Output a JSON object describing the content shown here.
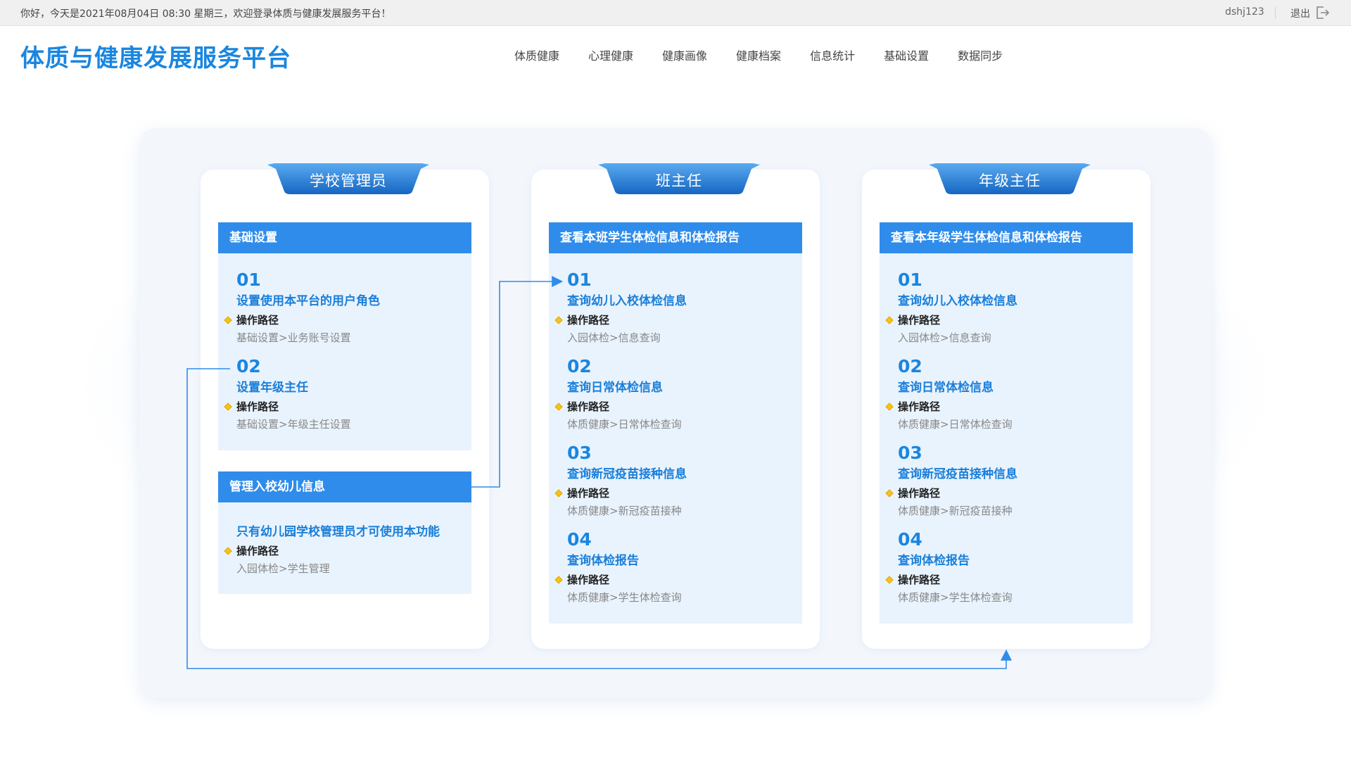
{
  "topbar": {
    "greeting": "你好，今天是2021年08月04日 08:30  星期三，欢迎登录体质与健康发展服务平台！",
    "username": "dshj123",
    "logout_label": "退出",
    "logout_icon": "logout-icon"
  },
  "header": {
    "brand": "体质与健康发展服务平台",
    "nav": [
      "体质健康",
      "心理健康",
      "健康画像",
      "健康档案",
      "信息统计",
      "基础设置",
      "数据同步"
    ]
  },
  "colors": {
    "accent": "#1a86e0",
    "section_head": "#2f8ceb",
    "section_body": "#e9f3fd",
    "ribbon": "#1f78d1",
    "diamond": "#f7c21b"
  },
  "op_label": "操作路径",
  "cards": [
    {
      "role": "学校管理员",
      "sections": [
        {
          "title": "基础设置",
          "items": [
            {
              "num": "01",
              "title": "设置使用本平台的用户角色",
              "path": "基础设置>业务账号设置"
            },
            {
              "num": "02",
              "title": "设置年级主任",
              "path": "基础设置>年级主任设置"
            }
          ]
        },
        {
          "title": "管理入校幼儿信息",
          "items": [
            {
              "num": "",
              "title": "只有幼儿园学校管理员才可使用本功能",
              "path": "入园体检>学生管理"
            }
          ]
        }
      ]
    },
    {
      "role": "班主任",
      "sections": [
        {
          "title": "查看本班学生体检信息和体检报告",
          "items": [
            {
              "num": "01",
              "title": "查询幼儿入校体检信息",
              "path": "入园体检>信息查询"
            },
            {
              "num": "02",
              "title": "查询日常体检信息",
              "path": "体质健康>日常体检查询"
            },
            {
              "num": "03",
              "title": "查询新冠疫苗接种信息",
              "path": "体质健康>新冠疫苗接种"
            },
            {
              "num": "04",
              "title": "查询体检报告",
              "path": "体质健康>学生体检查询"
            }
          ]
        }
      ]
    },
    {
      "role": "年级主任",
      "sections": [
        {
          "title": "查看本年级学生体检信息和体检报告",
          "items": [
            {
              "num": "01",
              "title": "查询幼儿入校体检信息",
              "path": "入园体检>信息查询"
            },
            {
              "num": "02",
              "title": "查询日常体检信息",
              "path": "体质健康>日常体检查询"
            },
            {
              "num": "03",
              "title": "查询新冠疫苗接种信息",
              "path": "体质健康>新冠疫苗接种"
            },
            {
              "num": "04",
              "title": "查询体检报告",
              "path": "体质健康>学生体检查询"
            }
          ]
        }
      ]
    }
  ]
}
